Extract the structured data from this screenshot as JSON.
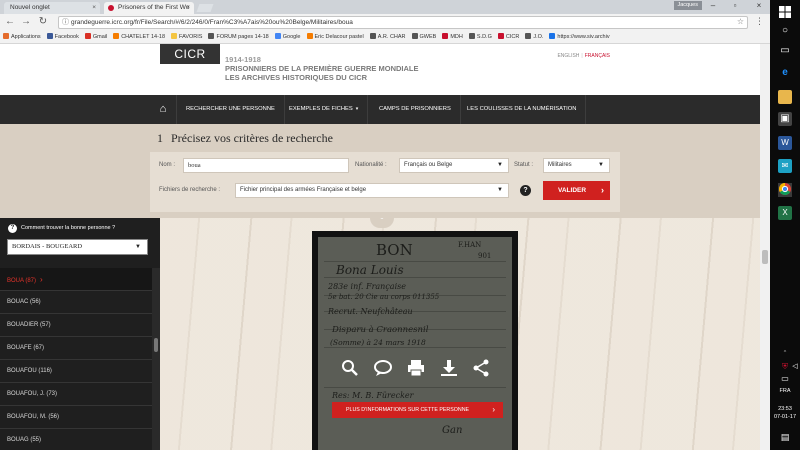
{
  "browser": {
    "tabs": [
      {
        "title": "Nouvel onglet"
      },
      {
        "title": "Prisoners of the First Wo"
      }
    ],
    "profile_label": "Jacques",
    "url": "grandeguerre.icrc.org/fr/File/Search/#/6/2/246/0/Fran%C3%A7ais%20ou%20Belge/Militaires/boua",
    "bookmarks": [
      {
        "label": "Applications",
        "color": "#e46b2c"
      },
      {
        "label": "Facebook",
        "color": "#3b5998"
      },
      {
        "label": "Gmail",
        "color": "#d93025"
      },
      {
        "label": "CHATELET 14-18",
        "color": "#f57c00"
      },
      {
        "label": "FAVORIS",
        "color": "#f4c542"
      },
      {
        "label": "FORUM pages 14-18",
        "color": "#555555"
      },
      {
        "label": "Google",
        "color": "#4285f4"
      },
      {
        "label": "Eric Delacour pastel",
        "color": "#f57c00"
      },
      {
        "label": "A.R. CHAR",
        "color": "#555555"
      },
      {
        "label": "GWEB",
        "color": "#555555"
      },
      {
        "label": "MDH",
        "color": "#c8102e"
      },
      {
        "label": "S.D.G",
        "color": "#555555"
      },
      {
        "label": "CICR",
        "color": "#c8102e"
      },
      {
        "label": "J.O.",
        "color": "#555555"
      },
      {
        "label": "https://www.siv.archiv",
        "color": "#1a73e8"
      }
    ]
  },
  "site": {
    "logo": "CICR",
    "title_years": "1914-1918",
    "title_line1": "PRISONNIERS DE LA PREMIÈRE GUERRE MONDIALE",
    "title_line2": "LES ARCHIVES HISTORIQUES DU CICR",
    "lang_en": "ENGLISH",
    "lang_fr": "FRANÇAIS",
    "nav": [
      {
        "label": "RECHERCHER UNE PERSONNE"
      },
      {
        "label": "EXEMPLES DE FICHES"
      },
      {
        "label": "CAMPS DE PRISONNIERS"
      },
      {
        "label": "LES COULISSES DE LA NUMÉRISATION"
      }
    ]
  },
  "search": {
    "step_number": "1",
    "step_title": "Précisez vos critères de recherche",
    "name_label": "Nom :",
    "name_value": "boua",
    "nationality_label": "Nationalité :",
    "nationality_value": "Français ou Belge",
    "status_label": "Statut :",
    "status_value": "Militaires",
    "files_label": "Fichiers de recherche :",
    "files_value": "Fichier principal des armées Française et belge",
    "validate_label": "VALIDER"
  },
  "sidebar": {
    "help_text": "Comment trouver la bonne personne ?",
    "range_value": "BORDAIS - BOUGEARD",
    "items": [
      {
        "label": "BOUA (87)"
      },
      {
        "label": "BOUAC (56)"
      },
      {
        "label": "BOUADIER (57)"
      },
      {
        "label": "BOUAFE (67)"
      },
      {
        "label": "BOUAFOU (116)"
      },
      {
        "label": "BOUAFOU, J. (73)"
      },
      {
        "label": "BOUAFOU, M. (56)"
      },
      {
        "label": "BOUAG (55)"
      }
    ]
  },
  "card": {
    "surname": "BON",
    "header_code": "F.HAN",
    "header_num": "901",
    "line1": "Bona Louis",
    "line2": "283e inf. Française",
    "line3": "5e bat. 20 Cie au corps 011355",
    "line4": "Recrut. Neufchâteau",
    "line5": "Disparu à Craonnesnil",
    "line6": "(Somme) à 24 mars 1918",
    "line7": "Res: M. B. Fürecker",
    "line8": "Gan",
    "more_label": "PLUS D'INFORMATIONS SUR CETTE PERSONNE"
  },
  "taskbar": {
    "lang": "FRA",
    "time": "23:53",
    "date": "07-01-17"
  }
}
